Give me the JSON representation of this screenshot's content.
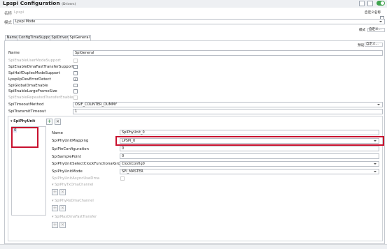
{
  "header": {
    "title": "Lpspi Configuration",
    "subtitle": "(Drivers)"
  },
  "top": {
    "name_label": "名称",
    "name_value": "Lpspi",
    "name_right": "自定义名称",
    "mode_label": "模式",
    "mode_value": "Lpspi Mode",
    "right_mode": "模式",
    "right_mode_value": "自定义..."
  },
  "tabs": [
    {
      "label": "Name"
    },
    {
      "label": "ConfigTimeSupport"
    },
    {
      "label": "SpiDriver"
    },
    {
      "label": "SpiGeneral"
    }
  ],
  "panel_top_right": {
    "label": "预设",
    "value": "自定义..."
  },
  "general": {
    "name_label": "Name",
    "name_value": "SpiGeneral",
    "opts": [
      {
        "label": "SpiEnableUserModeSupport",
        "checked": "",
        "disabled": true
      },
      {
        "label": "SpiEnableDmaFastTransferSupport",
        "checked": "",
        "disabled": false
      },
      {
        "label": "SpiHalfDuplexModeSupport",
        "checked": "",
        "disabled": false
      },
      {
        "label": "LpspiIpDevErrorDetect",
        "checked": "✓",
        "disabled": false
      },
      {
        "label": "SpiGlobalDmaEnable",
        "checked": "",
        "disabled": false
      },
      {
        "label": "SpiEnableLargeFrameSize",
        "checked": "",
        "disabled": false
      },
      {
        "label": "SpiEnableRepeatedTransferEnable",
        "checked": "",
        "disabled": true
      }
    ],
    "timeout_method_label": "SpiTimeoutMethod",
    "timeout_method_value": "OSIF_COUNTER_DUMMY",
    "transmit_timeout_label": "SpiTransmitTimeout",
    "transmit_timeout_value": "1"
  },
  "phy": {
    "header": "SpiPhyUnit",
    "list_item": "0",
    "name_label": "Name",
    "name_value": "SpiPhyUnit_0",
    "mapping_label": "SpiPhyUnitMapping",
    "mapping_value": "LPSPI_0",
    "pin_label": "SpiPinConfiguration",
    "pin_value": "0",
    "sample_label": "SpiSamplePoint",
    "sample_value": "0",
    "clock_label": "SpiPhyUnitSelectClockFunctionalGroup",
    "clock_value": "ClockConfig0",
    "mode_label": "SpiPhyUnitMode",
    "mode_value": "SPI_MASTER",
    "async_label": "SpiPhyUnitAsyncUseDma",
    "tx_channel": "SpiPhyTxDmaChannel",
    "rx_channel": "SpiPhyRxDmaChannel",
    "fast_transfer": "SpiMaxDmaFastTransfer"
  }
}
